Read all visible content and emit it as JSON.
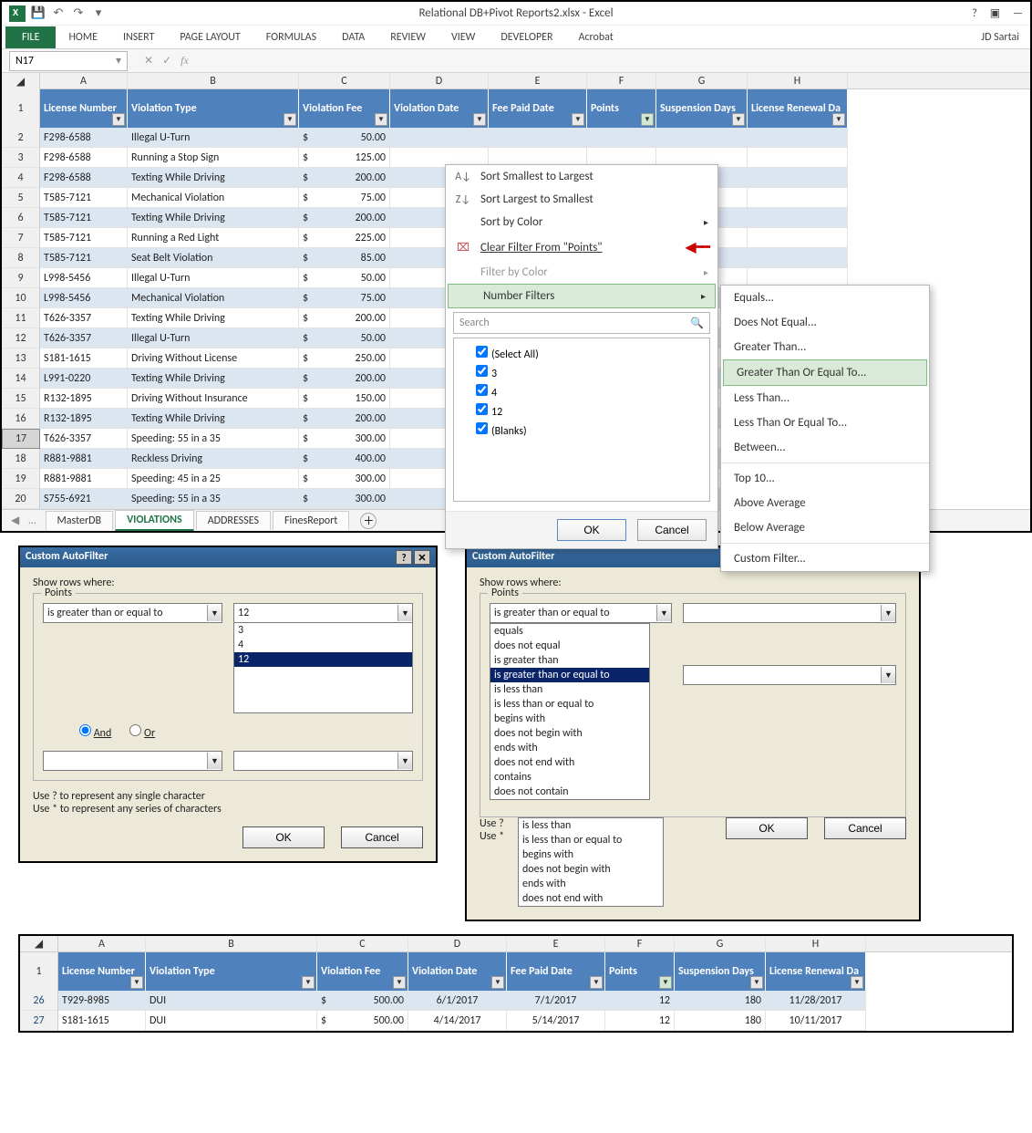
{
  "app": {
    "title": "Relational DB+Pivot Reports2.xlsx - Excel",
    "username": "JD Sartai"
  },
  "ribbon": {
    "file": "FILE",
    "tabs": [
      "HOME",
      "INSERT",
      "PAGE LAYOUT",
      "FORMULAS",
      "DATA",
      "REVIEW",
      "VIEW",
      "DEVELOPER",
      "Acrobat"
    ]
  },
  "namebox": "N17",
  "columns": [
    "A",
    "B",
    "C",
    "D",
    "E",
    "F",
    "G",
    "H"
  ],
  "headers": {
    "A": "License Number",
    "B": "Violation Type",
    "C": "Violation Fee",
    "D": "Violation Date",
    "E": "Fee Paid Date",
    "F": "Points",
    "G": "Suspension Days",
    "H": "License Renewal Da"
  },
  "rows": [
    {
      "n": 2,
      "lic": "F298-6588",
      "type": "Illegal U-Turn",
      "fee": "50.00"
    },
    {
      "n": 3,
      "lic": "F298-6588",
      "type": "Running a Stop Sign",
      "fee": "125.00"
    },
    {
      "n": 4,
      "lic": "F298-6588",
      "type": "Texting While Driving",
      "fee": "200.00"
    },
    {
      "n": 5,
      "lic": "T585-7121",
      "type": "Mechanical Violation",
      "fee": "75.00"
    },
    {
      "n": 6,
      "lic": "T585-7121",
      "type": "Texting While Driving",
      "fee": "200.00"
    },
    {
      "n": 7,
      "lic": "T585-7121",
      "type": "Running a Red Light",
      "fee": "225.00"
    },
    {
      "n": 8,
      "lic": "T585-7121",
      "type": "Seat Belt Violation",
      "fee": "85.00"
    },
    {
      "n": 9,
      "lic": "L998-5456",
      "type": "Illegal U-Turn",
      "fee": "50.00"
    },
    {
      "n": 10,
      "lic": "L998-5456",
      "type": "Mechanical Violation",
      "fee": "75.00"
    },
    {
      "n": 11,
      "lic": "T626-3357",
      "type": "Texting While Driving",
      "fee": "200.00"
    },
    {
      "n": 12,
      "lic": "T626-3357",
      "type": "Illegal U-Turn",
      "fee": "50.00"
    },
    {
      "n": 13,
      "lic": "S181-1615",
      "type": "Driving Without License",
      "fee": "250.00"
    },
    {
      "n": 14,
      "lic": "L991-0220",
      "type": "Texting While Driving",
      "fee": "200.00"
    },
    {
      "n": 15,
      "lic": "R132-1895",
      "type": "Driving Without Insurance",
      "fee": "150.00"
    },
    {
      "n": 16,
      "lic": "R132-1895",
      "type": "Texting While Driving",
      "fee": "200.00"
    },
    {
      "n": 17,
      "lic": "T626-3357",
      "type": "Speeding: 55 in a 35",
      "fee": "300.00"
    },
    {
      "n": 18,
      "lic": "R881-9881",
      "type": "Reckless Driving",
      "fee": "400.00"
    },
    {
      "n": 19,
      "lic": "R881-9881",
      "type": "Speeding: 45 in a 25",
      "fee": "300.00"
    },
    {
      "n": 20,
      "lic": "S755-6921",
      "type": "Speeding: 55 in a 35",
      "fee": "300.00"
    }
  ],
  "filtermenu": {
    "sort_asc": "Sort Smallest to Largest",
    "sort_desc": "Sort Largest to Smallest",
    "sort_color": "Sort by Color",
    "clear": "Clear Filter From \"Points\"",
    "filter_color": "Filter by Color",
    "number_filters": "Number Filters",
    "search_ph": "Search",
    "items": [
      "(Select All)",
      "3",
      "4",
      "12",
      "(Blanks)"
    ],
    "ok": "OK",
    "cancel": "Cancel"
  },
  "submenu": {
    "items1": [
      "Equals...",
      "Does Not Equal...",
      "Greater Than...",
      "Greater Than Or Equal To...",
      "Less Than...",
      "Less Than Or Equal To...",
      "Between..."
    ],
    "items2": [
      "Top 10...",
      "Above Average",
      "Below Average"
    ],
    "items3": [
      "Custom Filter..."
    ],
    "selected": "Greater Than Or Equal To..."
  },
  "sheets": {
    "nav": "…",
    "tabs": [
      "MasterDB",
      "VIOLATIONS",
      "ADDRESSES",
      "FinesReport"
    ],
    "active": "VIOLATIONS"
  },
  "dialog1": {
    "title": "Custom AutoFilter",
    "show_rows": "Show rows where:",
    "field": "Points",
    "op": "is greater than or equal to",
    "value": "12",
    "list": [
      "3",
      "4",
      "12"
    ],
    "list_selected": "12",
    "and": "And",
    "or": "Or",
    "help1": "Use ? to represent any single character",
    "help2": "Use * to represent any series of characters",
    "ok": "OK",
    "cancel": "Cancel"
  },
  "dialog2": {
    "title": "Custom AutoFilter",
    "show_rows": "Show rows where:",
    "field": "Points",
    "op": "is greater than or equal to",
    "ops_top": [
      "equals",
      "does not equal",
      "is greater than",
      "is greater than or equal to",
      "is less than",
      "is less than or equal to",
      "begins with",
      "does not begin with",
      "ends with",
      "does not end with",
      "contains",
      "does not contain"
    ],
    "ops_bottom": [
      "is less than",
      "is less than or equal to",
      "begins with",
      "does not begin with",
      "ends with",
      "does not end with"
    ],
    "use_prefix": "Use ?",
    "use_prefix2": "Use *",
    "ok": "OK",
    "cancel": "Cancel"
  },
  "result": {
    "rows": [
      {
        "n": 26,
        "lic": "T929-8985",
        "type": "DUI",
        "fee": "500.00",
        "vdate": "6/1/2017",
        "pdate": "7/1/2017",
        "pts": "12",
        "susp": "180",
        "renew": "11/28/2017"
      },
      {
        "n": 27,
        "lic": "S181-1615",
        "type": "DUI",
        "fee": "500.00",
        "vdate": "4/14/2017",
        "pdate": "5/14/2017",
        "pts": "12",
        "susp": "180",
        "renew": "10/11/2017"
      }
    ]
  }
}
